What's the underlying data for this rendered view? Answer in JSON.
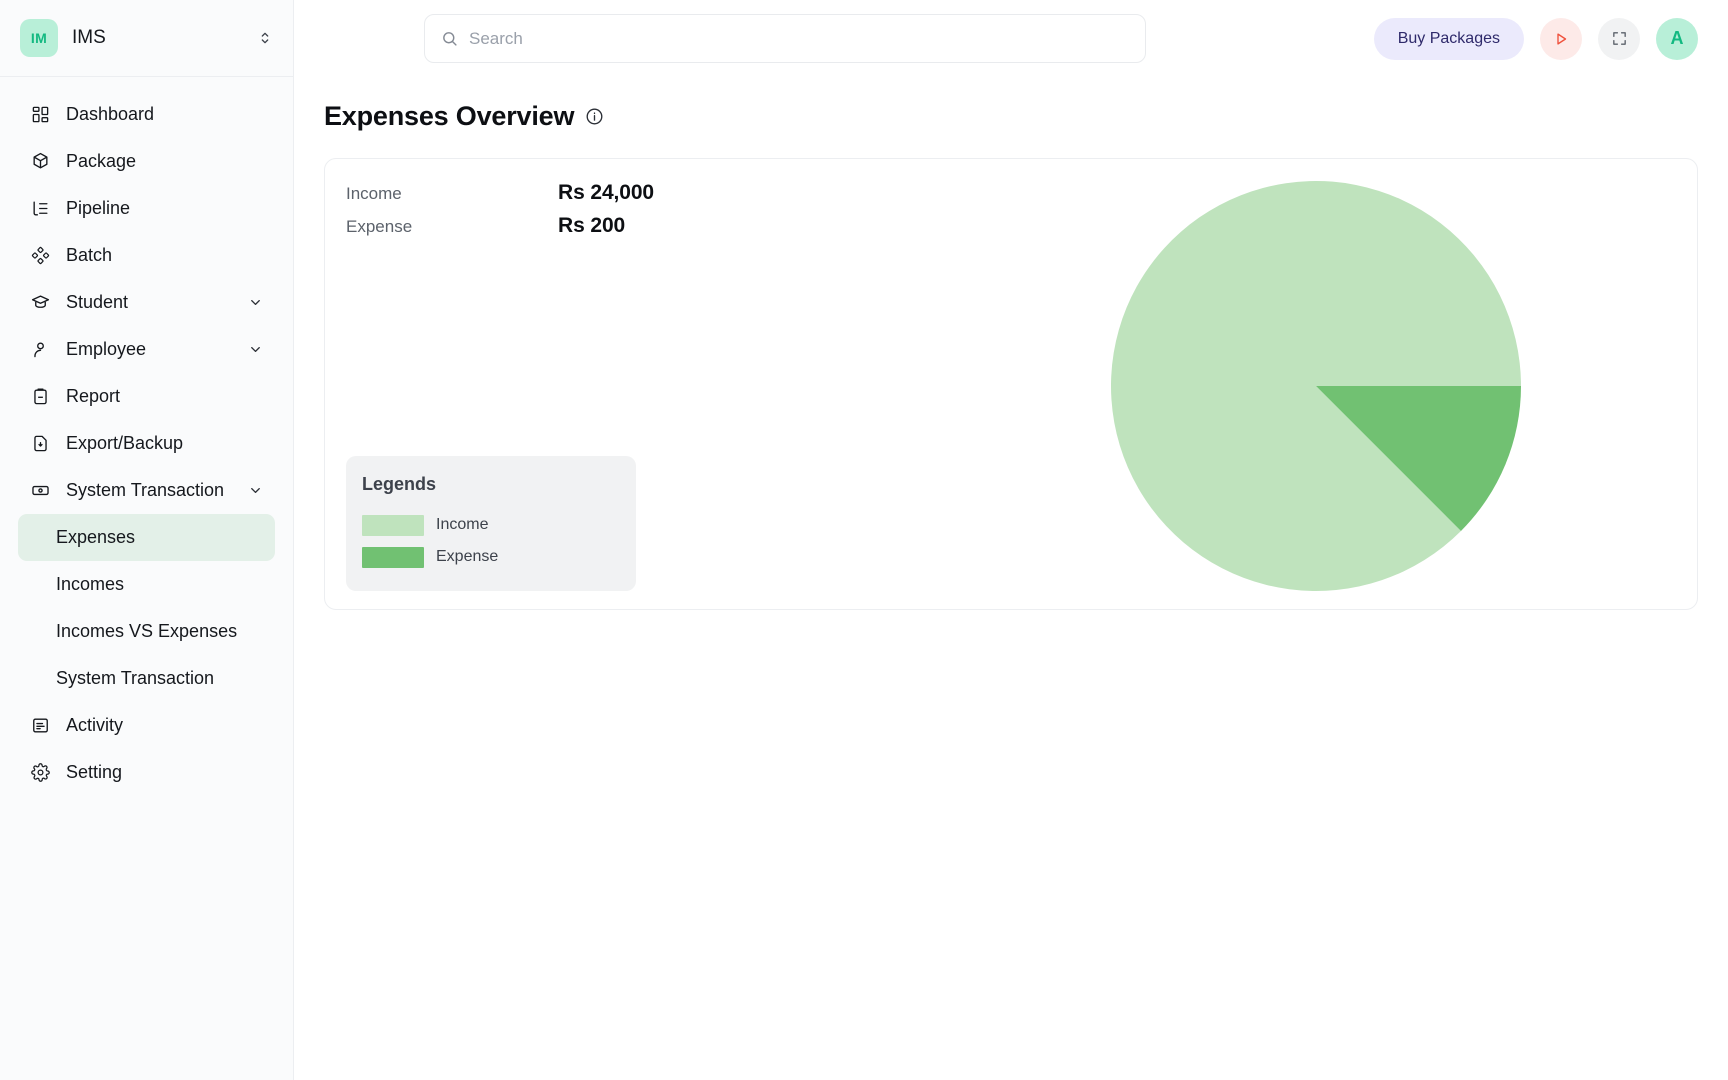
{
  "brand": {
    "badge_text": "IM",
    "name": "IMS",
    "switch_icon": "chevron-up-down-icon"
  },
  "sidebar": {
    "items": [
      {
        "label": "Dashboard",
        "icon": "grid-icon",
        "expandable": false
      },
      {
        "label": "Package",
        "icon": "package-icon",
        "expandable": false
      },
      {
        "label": "Pipeline",
        "icon": "pipeline-icon",
        "expandable": false
      },
      {
        "label": "Batch",
        "icon": "batch-icon",
        "expandable": false
      },
      {
        "label": "Student",
        "icon": "graduation-icon",
        "expandable": true
      },
      {
        "label": "Employee",
        "icon": "user-icon",
        "expandable": true
      },
      {
        "label": "Report",
        "icon": "clipboard-icon",
        "expandable": false
      },
      {
        "label": "Export/Backup",
        "icon": "file-download-icon",
        "expandable": false
      },
      {
        "label": "System Transaction",
        "icon": "banknote-icon",
        "expandable": true
      }
    ],
    "sub_items": [
      {
        "label": "Expenses",
        "active": true
      },
      {
        "label": "Incomes",
        "active": false
      },
      {
        "label": "Incomes VS Expenses",
        "active": false
      },
      {
        "label": "System Transaction",
        "active": false
      }
    ],
    "tail_items": [
      {
        "label": "Activity",
        "icon": "activity-log-icon",
        "expandable": false
      },
      {
        "label": "Setting",
        "icon": "gear-icon",
        "expandable": false
      }
    ]
  },
  "topbar": {
    "search_placeholder": "Search",
    "search_value": "",
    "search_icon": "search-icon",
    "buy_packages_label": "Buy Packages",
    "play_icon": "play-icon",
    "expand_icon": "fullscreen-icon",
    "avatar_initial": "A"
  },
  "main": {
    "page_title": "Expenses Overview",
    "info_icon": "info-circle-icon",
    "stats": [
      {
        "label": "Income",
        "value": "Rs 24,000"
      },
      {
        "label": "Expense",
        "value": "Rs 200"
      }
    ],
    "legends_title": "Legends"
  },
  "colors": {
    "income": "#bfe3bd",
    "expense": "#71c172",
    "brand_mint": "#b8efd8",
    "brand_green": "#13b981",
    "buy_bg": "#ebeafc",
    "buy_fg": "#2f2a6b",
    "play_bg": "#fdeae8",
    "play_fg": "#f0513c",
    "active_nav_bg": "#e3f0e8"
  },
  "chart_data": {
    "type": "pie",
    "title": "Expenses Overview",
    "categories": [
      "Income",
      "Expense"
    ],
    "values": [
      24000,
      200
    ],
    "display_values": [
      "Rs 24,000",
      "Rs 200"
    ],
    "colors": [
      "#bfe3bd",
      "#71c172"
    ],
    "legend_position": "left-bottom",
    "slices": [
      {
        "name": "Income",
        "value": 24000,
        "percent": 87.5,
        "start_angle": 45,
        "end_angle": 360,
        "color": "#bfe3bd"
      },
      {
        "name": "Expense",
        "value": 200,
        "percent": 12.5,
        "start_angle": 0,
        "end_angle": 45,
        "color": "#71c172"
      }
    ],
    "grid": false
  }
}
